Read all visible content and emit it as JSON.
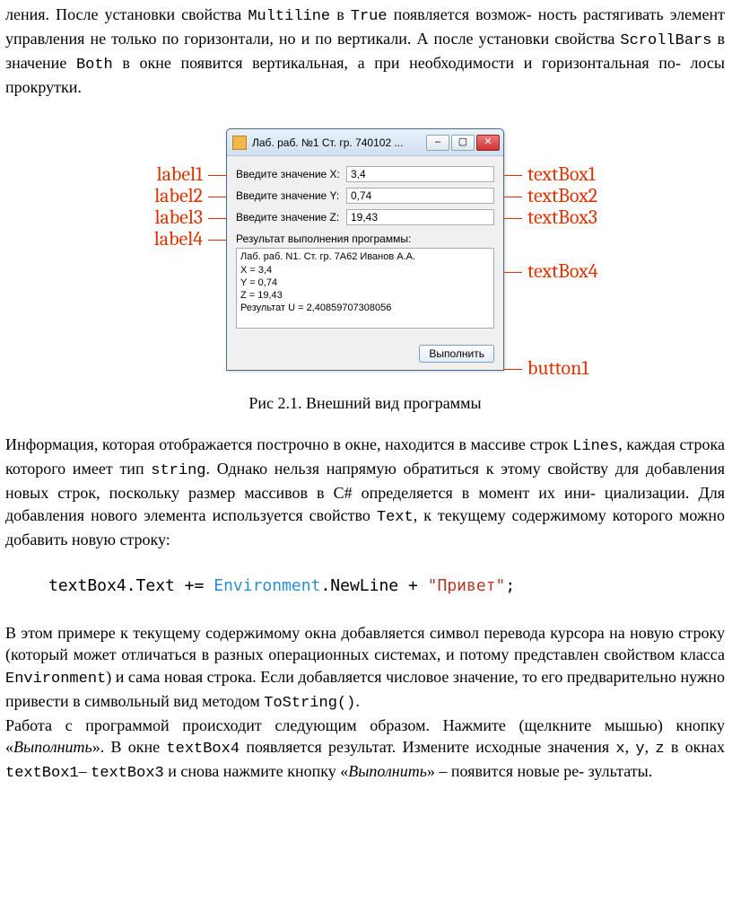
{
  "para1_a": "ления. После установки свойства ",
  "para1_m1": "Multiline",
  "para1_b": " в ",
  "para1_m2": "True",
  "para1_c": " появляется возмож- ность растягивать элемент управления не только по горизонтали, но и по вертикали. А после установки свойства ",
  "para1_m3": "ScrollBars",
  "para1_d": " в значение ",
  "para1_m4": "Both",
  "para1_e": " в окне появится вертикальная, а при необходимости и горизонтальная по- лосы прокрутки.",
  "ann": {
    "l1": "label1",
    "l2": "label2",
    "l3": "label3",
    "l4": "label4",
    "t1": "textBox1",
    "t2": "textBox2",
    "t3": "textBox3",
    "t4": "textBox4",
    "b1": "button1"
  },
  "win": {
    "title": "Лаб. раб. №1 Ст. гр. 740102 ...",
    "labelX": "Введите значение X:",
    "labelY": "Введите значение Y:",
    "labelZ": "Введите значение Z:",
    "labelRes": "Результат выполнения программы:",
    "valX": "3,4",
    "valY": "0,74",
    "valZ": "19,43",
    "multiline": "Лаб. раб. N1. Ст. гр. 7А62 Иванов А.А.\nX = 3,4\nY = 0,74\nZ = 19,43\nРезультат U = 2,40859707308056",
    "button": "Выполнить"
  },
  "caption": "Рис 2.1. Внешний вид программы",
  "para2_a": "Информация, которая отображается построчно в окне, находится в массиве строк ",
  "para2_m1": "Lines",
  "para2_b": ", каждая строка которого имеет тип ",
  "para2_m2": "string",
  "para2_c": ". Однако нельзя напрямую обратиться к этому свойству для добавления новых строк, поскольку размер массивов в C# определяется в момент их ини- циализации. Для добавления нового элемента используется свойство ",
  "para2_m3": "Text",
  "para2_d": ", к текущему содержимому которого можно добавить новую строку:",
  "code": {
    "a": "textBox4.Text += ",
    "env": "Environment",
    "b": ".NewLine + ",
    "str": "\"Привет\"",
    "c": ";"
  },
  "para3_a": "В этом примере к текущему содержимому окна добавляется символ перевода курсора на новую строку (который может отличаться в разных операционных системах, и потому представлен свойством класса ",
  "para3_m1": "Environment",
  "para3_b": ") и сама новая строка. Если добавляется числовое значение, то его предварительно нужно привести в символьный вид методом ",
  "para3_m2": "ToString()",
  "para3_c": ".",
  "para4_a": "Работа с программой происходит следующим образом. Нажмите (щелкните мышью) кнопку «",
  "para4_em1": "Выполнить",
  "para4_b": "». В окне ",
  "para4_m1": "textBox4",
  "para4_c": " появляется результат. Измените исходные значения ",
  "para4_m2": "x",
  "para4_d": ", ",
  "para4_m3": "y",
  "para4_e": ", ",
  "para4_m4": "z",
  "para4_f": " в окнах ",
  "para4_m5": "textBox1",
  "para4_g": "– ",
  "para4_m6": "textBox3",
  "para4_h": " и снова нажмите кнопку «",
  "para4_em2": "Выполнить",
  "para4_i": "» – появится новые ре- зультаты."
}
